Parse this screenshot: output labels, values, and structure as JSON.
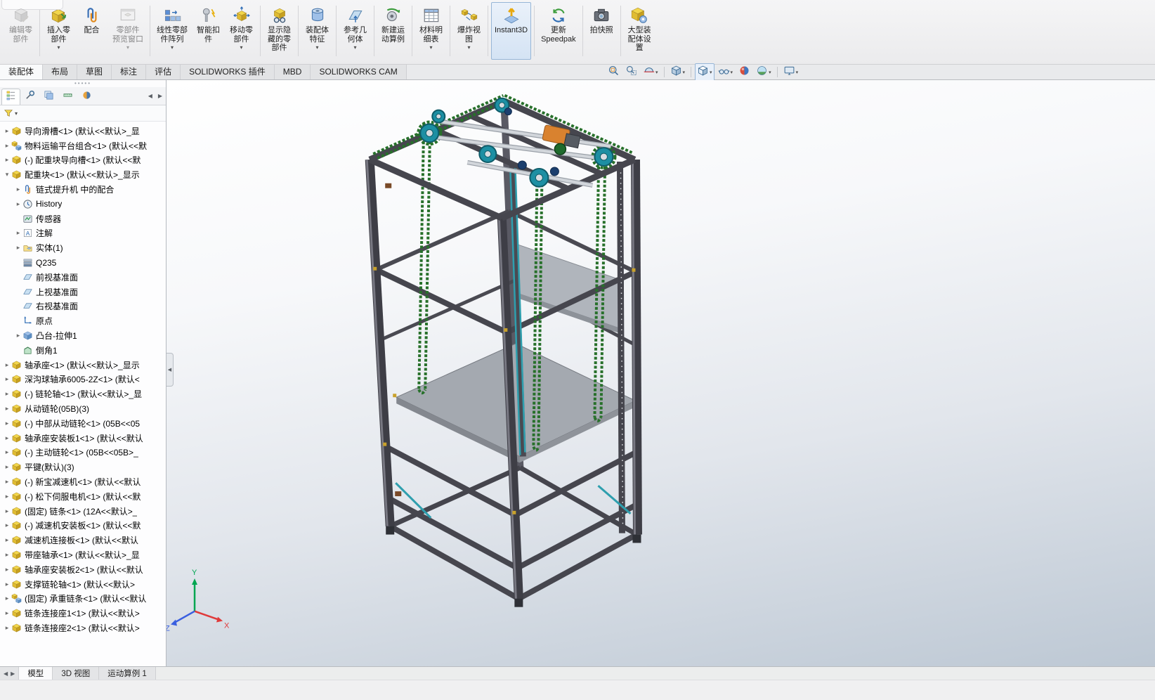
{
  "colors": {
    "accent_blue": "#2f6db5",
    "ribbon_active_bg": "#d4e3f4",
    "viewport_gradient_top": "#ffffff",
    "viewport_gradient_bottom": "#bdc8d4",
    "frame_gray": "#3e3e46",
    "chain_green": "#27702a",
    "pulley_teal": "#1d8fa3",
    "motor_orange": "#d9822f",
    "triad_x_red": "#e03a3a",
    "triad_y_green": "#00a651",
    "triad_z_blue": "#3a5fe0"
  },
  "ribbon": {
    "items": [
      {
        "icon": "edit-component",
        "label_lines": [
          "编辑零",
          "部件"
        ],
        "disabled": true
      },
      {
        "sep": true
      },
      {
        "icon": "insert-components",
        "label_lines": [
          "插入零",
          "部件"
        ],
        "dropdown": true
      },
      {
        "icon": "mate",
        "label_lines": [
          "配合"
        ]
      },
      {
        "icon": "component-preview",
        "label_lines": [
          "零部件",
          "预览窗口"
        ],
        "disabled": true,
        "dropdown": true
      },
      {
        "sep": true
      },
      {
        "icon": "linear-pattern",
        "label_lines": [
          "线性零部",
          "件阵列"
        ],
        "dropdown": true
      },
      {
        "icon": "smart-fasteners",
        "label_lines": [
          "智能扣",
          "件"
        ]
      },
      {
        "icon": "move-component",
        "label_lines": [
          "移动零",
          "部件"
        ],
        "dropdown": true
      },
      {
        "sep": true
      },
      {
        "icon": "show-hidden",
        "label_lines": [
          "显示隐",
          "藏的零",
          "部件"
        ]
      },
      {
        "sep": true
      },
      {
        "icon": "assembly-features",
        "label_lines": [
          "装配体",
          "特征"
        ],
        "dropdown": true
      },
      {
        "sep": true
      },
      {
        "icon": "reference-geometry",
        "label_lines": [
          "参考几",
          "何体"
        ],
        "dropdown": true
      },
      {
        "sep": true
      },
      {
        "icon": "new-motion-study",
        "label_lines": [
          "新建运",
          "动算例"
        ]
      },
      {
        "sep": true
      },
      {
        "icon": "bom",
        "label_lines": [
          "材料明",
          "细表"
        ],
        "dropdown": true
      },
      {
        "sep": true
      },
      {
        "icon": "exploded-view",
        "label_lines": [
          "爆炸视",
          "图"
        ],
        "dropdown": true
      },
      {
        "sep": true
      },
      {
        "icon": "instant3d",
        "label_lines": [
          "Instant3D"
        ],
        "active": true
      },
      {
        "sep": true
      },
      {
        "icon": "update-speedpak",
        "label_lines": [
          "更新",
          "Speedpak"
        ]
      },
      {
        "sep": true
      },
      {
        "icon": "snapshot",
        "label_lines": [
          "拍快照"
        ]
      },
      {
        "sep": true
      },
      {
        "icon": "large-assembly",
        "label_lines": [
          "大型装",
          "配体设",
          "置"
        ]
      }
    ]
  },
  "command_tabs": {
    "items": [
      {
        "label": "装配体",
        "active": true
      },
      {
        "label": "布局"
      },
      {
        "label": "草图"
      },
      {
        "label": "标注"
      },
      {
        "label": "评估"
      },
      {
        "label": "SOLIDWORKS 插件"
      },
      {
        "label": "MBD"
      },
      {
        "label": "SOLIDWORKS CAM"
      }
    ]
  },
  "headsup": {
    "items": [
      {
        "icon": "hud-zoom-fit"
      },
      {
        "icon": "hud-zoom-area"
      },
      {
        "icon": "hud-section",
        "caret": true
      },
      {
        "sep": true
      },
      {
        "icon": "hud-view-orientation",
        "caret": true
      },
      {
        "sep": true
      },
      {
        "icon": "hud-display-style",
        "caret": true,
        "boxed": true
      },
      {
        "icon": "hud-hide-show",
        "caret": true
      },
      {
        "icon": "hud-edit-appearance"
      },
      {
        "icon": "hud-apply-scene",
        "caret": true
      },
      {
        "sep": true
      },
      {
        "icon": "hud-view-settings",
        "caret": true
      }
    ]
  },
  "panel": {
    "manager_tabs": [
      {
        "icon": "mgr-feature",
        "active": true
      },
      {
        "icon": "mgr-property"
      },
      {
        "icon": "mgr-config"
      },
      {
        "icon": "mgr-dimxpert"
      },
      {
        "icon": "mgr-display"
      }
    ],
    "nav": {
      "left": "◀",
      "right": "▶"
    },
    "tree": {
      "scroll_up": "∧",
      "scroll_down": "∨",
      "items": [
        {
          "arrow": "right",
          "icon": "part",
          "label": "导向滑槽<1> (默认<<默认>_显"
        },
        {
          "arrow": "right",
          "icon": "assembly",
          "label": "物料运输平台组合<1> (默认<<默"
        },
        {
          "arrow": "right",
          "icon": "part",
          "label": "(-) 配重块导向槽<1> (默认<<默"
        },
        {
          "arrow": "down",
          "icon": "part",
          "label": "配重块<1> (默认<<默认>_显示"
        },
        {
          "arrow": "right",
          "icon": "mates",
          "label": "链式提升机 中的配合",
          "indent": 1
        },
        {
          "arrow": "right",
          "icon": "history",
          "label": "History",
          "indent": 1
        },
        {
          "arrow": "none",
          "icon": "sensors",
          "label": "传感器",
          "indent": 1
        },
        {
          "arrow": "right",
          "icon": "annotations",
          "label": "注解",
          "indent": 1
        },
        {
          "arrow": "right",
          "icon": "solids",
          "label": "实体(1)",
          "indent": 1
        },
        {
          "arrow": "none",
          "icon": "material",
          "label": "Q235",
          "indent": 1
        },
        {
          "arrow": "none",
          "icon": "plane",
          "label": "前视基准面",
          "indent": 1
        },
        {
          "arrow": "none",
          "icon": "plane",
          "label": "上视基准面",
          "indent": 1
        },
        {
          "arrow": "none",
          "icon": "plane",
          "label": "右视基准面",
          "indent": 1
        },
        {
          "arrow": "none",
          "icon": "origin",
          "label": "原点",
          "indent": 1
        },
        {
          "arrow": "right",
          "icon": "extrude",
          "label": "凸台-拉伸1",
          "indent": 1
        },
        {
          "arrow": "none",
          "icon": "chamfer",
          "label": "倒角1",
          "indent": 1
        },
        {
          "arrow": "right",
          "icon": "part",
          "label": "轴承座<1> (默认<<默认>_显示"
        },
        {
          "arrow": "right",
          "icon": "part",
          "label": "深沟球轴承6005-2Z<1> (默认<"
        },
        {
          "arrow": "right",
          "icon": "part",
          "label": "(-) 链轮轴<1> (默认<<默认>_显"
        },
        {
          "arrow": "right",
          "icon": "part",
          "label": "从动链轮(05B)(3)"
        },
        {
          "arrow": "right",
          "icon": "part",
          "label": "(-) 中部从动链轮<1> (05B<<05"
        },
        {
          "arrow": "right",
          "icon": "part",
          "label": "轴承座安装板1<1> (默认<<默认"
        },
        {
          "arrow": "right",
          "icon": "part",
          "label": "(-) 主动链轮<1> (05B<<05B>_"
        },
        {
          "arrow": "right",
          "icon": "part",
          "label": "平键(默认)(3)"
        },
        {
          "arrow": "right",
          "icon": "part",
          "label": "(-) 新宝减速机<1> (默认<<默认"
        },
        {
          "arrow": "right",
          "icon": "part",
          "label": "(-) 松下伺服电机<1> (默认<<默"
        },
        {
          "arrow": "right",
          "icon": "part",
          "label": "(固定) 链条<1> (12A<<默认>_"
        },
        {
          "arrow": "right",
          "icon": "part",
          "label": "(-) 减速机安装板<1> (默认<<默"
        },
        {
          "arrow": "right",
          "icon": "part",
          "label": "减速机连接板<1> (默认<<默认"
        },
        {
          "arrow": "right",
          "icon": "part",
          "label": "带座轴承<1> (默认<<默认>_显"
        },
        {
          "arrow": "right",
          "icon": "part",
          "label": "轴承座安装板2<1> (默认<<默认"
        },
        {
          "arrow": "right",
          "icon": "part",
          "label": "支撑链轮轴<1> (默认<<默认>"
        },
        {
          "arrow": "right",
          "icon": "assembly",
          "label": "(固定) 承重链条<1> (默认<<默认"
        },
        {
          "arrow": "right",
          "icon": "part",
          "label": "链条连接座1<1> (默认<<默认>"
        },
        {
          "arrow": "right",
          "icon": "part",
          "label": "链条连接座2<1> (默认<<默认>"
        }
      ]
    }
  },
  "viewport": {
    "triad": {
      "x_label": "X",
      "y_label": "Y",
      "z_label": "Z"
    }
  },
  "bottom": {
    "nav": {
      "left": "◀",
      "right": "▶"
    },
    "tabs": [
      {
        "label": "模型",
        "active": true
      },
      {
        "label": "3D 视图"
      },
      {
        "label": "运动算例 1"
      }
    ]
  }
}
